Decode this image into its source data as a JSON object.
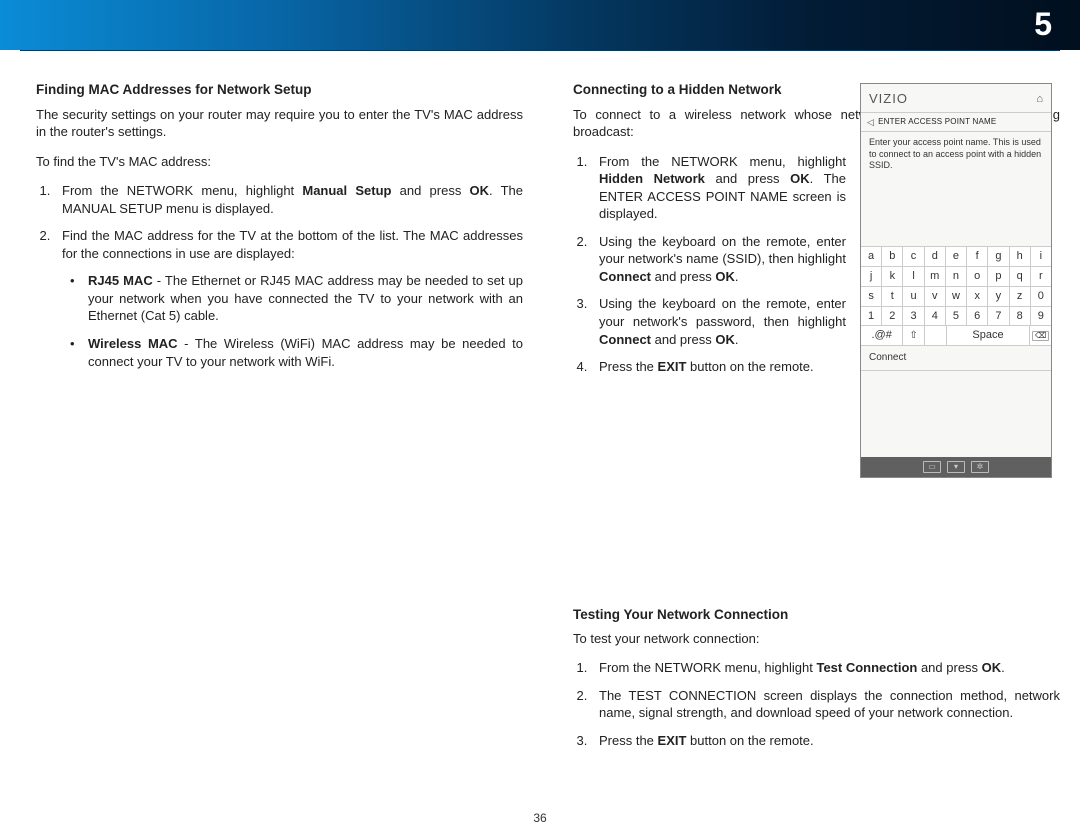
{
  "chapter_number": "5",
  "page_number": "36",
  "left_col": {
    "h_mac": "Finding MAC Addresses for Network Setup",
    "p_mac_intro": "The security settings on your router may require you to enter the TV's MAC address in the router's settings.",
    "p_mac_find": "To find the TV's MAC address:",
    "step1_a": "From the NETWORK menu, highlight ",
    "step1_b": "Manual Setup",
    "step1_c": " and press ",
    "step1_d": "OK",
    "step1_e": ". The MANUAL SETUP menu is displayed.",
    "step2": "Find the MAC address for the TV at the bottom of the list. The MAC addresses for the connections in use are displayed:",
    "rj45_b": "RJ45 MAC",
    "rj45_t": " - The Ethernet or RJ45 MAC address may be needed to set up your network when you have connected the TV to your network with an Ethernet (Cat 5) cable.",
    "wmac_b": "Wireless MAC",
    "wmac_t": " - The Wireless (WiFi) MAC address may be needed to connect your TV to your network with WiFi."
  },
  "right_col": {
    "h_hidden": "Connecting to a Hidden Network",
    "p_hidden_intro": "To connect to a wireless network whose network name (SSID) is not being broadcast:",
    "s1_a": "From the NETWORK menu, highlight ",
    "s1_b": "Hidden Network",
    "s1_c": " and press ",
    "s1_d": "OK",
    "s1_e": ". The ENTER ACCESS POINT NAME screen is displayed.",
    "s2_a": "Using the keyboard on the remote, enter your network's name (SSID), then highlight ",
    "s2_b": "Connect",
    "s2_c": " and press ",
    "s2_d": "OK",
    "s2_e": ".",
    "s3_a": "Using the keyboard on the remote, enter your network's password, then highlight ",
    "s3_b": "Connect",
    "s3_c": " and press ",
    "s3_d": "OK",
    "s3_e": ".",
    "s4_a": "Press the ",
    "s4_b": "EXIT",
    "s4_c": " button on the remote.",
    "h_test": "Testing Your Network Connection",
    "p_test_intro": "To test your network connection:",
    "t1_a": "From the NETWORK menu, highlight ",
    "t1_b": "Test Connection",
    "t1_c": " and press ",
    "t1_d": "OK",
    "t1_e": ".",
    "t2": "The TEST CONNECTION screen displays the connection method, network name, signal strength, and download speed of your network connection.",
    "t3_a": "Press the ",
    "t3_b": "EXIT",
    "t3_c": " button on the remote."
  },
  "inset": {
    "brand": "VIZIO",
    "title": "ENTER ACCESS POINT NAME",
    "desc": "Enter your access point name. This is used to connect to an access point with a hidden SSID.",
    "connect": "Connect",
    "keys": {
      "r1": [
        "a",
        "b",
        "c",
        "d",
        "e",
        "f",
        "g",
        "h",
        "i"
      ],
      "r2": [
        "j",
        "k",
        "l",
        "m",
        "n",
        "o",
        "p",
        "q",
        "r"
      ],
      "r3": [
        "s",
        "t",
        "u",
        "v",
        "w",
        "x",
        "y",
        "z",
        "0"
      ],
      "r4": [
        "1",
        "2",
        "3",
        "4",
        "5",
        "6",
        "7",
        "8",
        "9"
      ],
      "sym": ".@#",
      "shift": "⇧",
      "space": "Space",
      "bksp": "⌫"
    }
  }
}
